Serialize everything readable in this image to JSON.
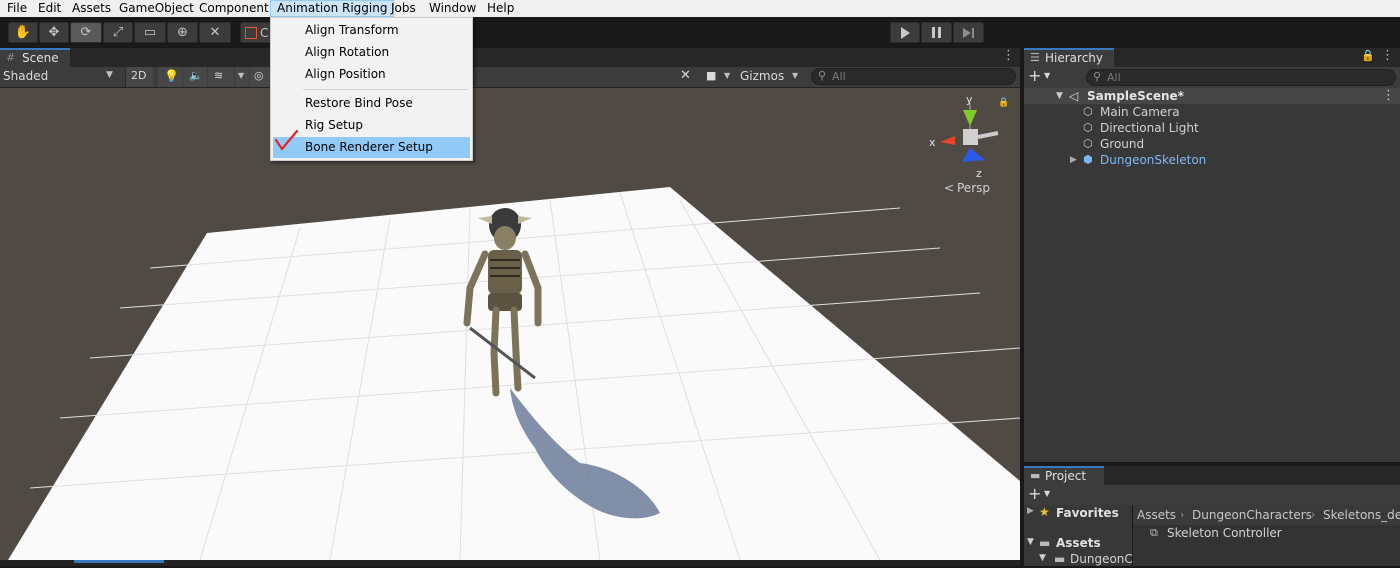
{
  "menu": {
    "items": [
      {
        "label": "File"
      },
      {
        "label": "Edit"
      },
      {
        "label": "Assets"
      },
      {
        "label": "GameObject"
      },
      {
        "label": "Component"
      },
      {
        "label": "Animation Rigging"
      },
      {
        "label": "Jobs"
      },
      {
        "label": "Window"
      },
      {
        "label": "Help"
      }
    ],
    "active": "Animation Rigging"
  },
  "dropdown": {
    "items": [
      {
        "label": "Align Transform"
      },
      {
        "label": "Align Rotation"
      },
      {
        "label": "Align Position"
      },
      {
        "label": "Restore Bind Pose"
      },
      {
        "label": "Rig Setup"
      },
      {
        "label": "Bone Renderer Setup"
      }
    ],
    "highlighted": "Bone Renderer Setup",
    "annotation_mark": "red-checkmark"
  },
  "toolbar": {
    "tools": [
      "hand-icon",
      "move-icon",
      "rotate-icon",
      "scale-icon",
      "rect-icon",
      "transform-icon",
      "custom-tool-icon"
    ],
    "active_tool": "rotate-icon",
    "partial_label": "C",
    "play_controls": [
      "play-icon",
      "pause-icon",
      "step-icon"
    ]
  },
  "scene": {
    "tab_label": "Scene",
    "shading_mode": "Shaded",
    "mode_2d": "2D",
    "gizmos_label": "Gizmos",
    "search_placeholder": "All",
    "gizmo_labels": {
      "y": "y",
      "x": "x",
      "z": "z"
    },
    "projection_label": "Persp"
  },
  "hierarchy": {
    "tab_label": "Hierarchy",
    "search_placeholder": "All",
    "scene_name": "SampleScene*",
    "objects": [
      {
        "label": "Main Camera"
      },
      {
        "label": "Directional Light"
      },
      {
        "label": "Ground"
      },
      {
        "label": "DungeonSkeleton"
      }
    ]
  },
  "project": {
    "tab_label": "Project",
    "favorites_label": "Favorites",
    "assets_label": "Assets",
    "sub_folder": "DungeonC",
    "breadcrumb": [
      "Assets",
      "DungeonCharacters",
      "Skeletons_der"
    ],
    "files": [
      {
        "label": "Skeleton Controller"
      }
    ]
  },
  "colors": {
    "accent_blue": "#3a79bb",
    "prefab_text": "#7eb7f5",
    "menu_highlight": "#91c9f7",
    "check_red": "#e8222b",
    "scene_bg": "#504a45"
  }
}
